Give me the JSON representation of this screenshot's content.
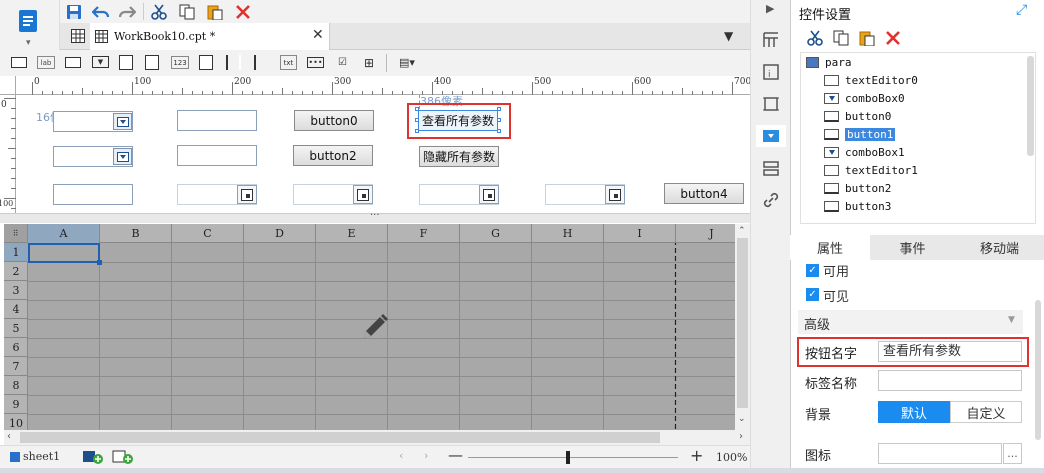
{
  "toolbar": {
    "icons": [
      "sheet-icon",
      "save-icon",
      "undo-icon",
      "redo-icon",
      "cut-icon",
      "copy-icon",
      "paste-icon",
      "delete-icon"
    ]
  },
  "tab": {
    "label": "WorkBook10.cpt *"
  },
  "ruler": {
    "h_ticks": [
      "0",
      "100",
      "200",
      "300",
      "400",
      "500",
      "600",
      "700"
    ],
    "v_ticks": [
      "0",
      "100"
    ]
  },
  "canvas": {
    "label_16px": "16像素",
    "label_386px": "386像素",
    "buttons": {
      "button0": "button0",
      "button2": "button2",
      "button4": "button4",
      "view_all": "查看所有参数",
      "hide_all": "隐藏所有参数"
    }
  },
  "sheet": {
    "columns": [
      "A",
      "B",
      "C",
      "D",
      "E",
      "F",
      "G",
      "H",
      "I",
      "J"
    ],
    "rows": [
      "1",
      "2",
      "3",
      "4",
      "5",
      "6",
      "7",
      "8",
      "9",
      "10"
    ],
    "tab": "sheet1",
    "zoom": "100%"
  },
  "right_panel": {
    "title": "控件设置",
    "tree_root": "para",
    "tree_items": [
      "textEditor0",
      "comboBox0",
      "button0",
      "button1",
      "comboBox1",
      "textEditor1",
      "button2",
      "button3"
    ],
    "selected": "button1",
    "tabs": [
      "属性",
      "事件",
      "移动端"
    ],
    "props": {
      "enabled": "可用",
      "visible": "可见",
      "advanced": "高级",
      "button_name_label": "按钮名字",
      "button_name_value": "查看所有参数",
      "tag_label": "标签名称",
      "tag_value": "",
      "bg_label": "背景",
      "bg_default": "默认",
      "bg_custom": "自定义",
      "icon_label": "图标",
      "icon_more": "..."
    }
  },
  "colors": {
    "accent": "#1a8cf0",
    "red_highlight": "#e0322f",
    "selection": "#3a88e0"
  }
}
